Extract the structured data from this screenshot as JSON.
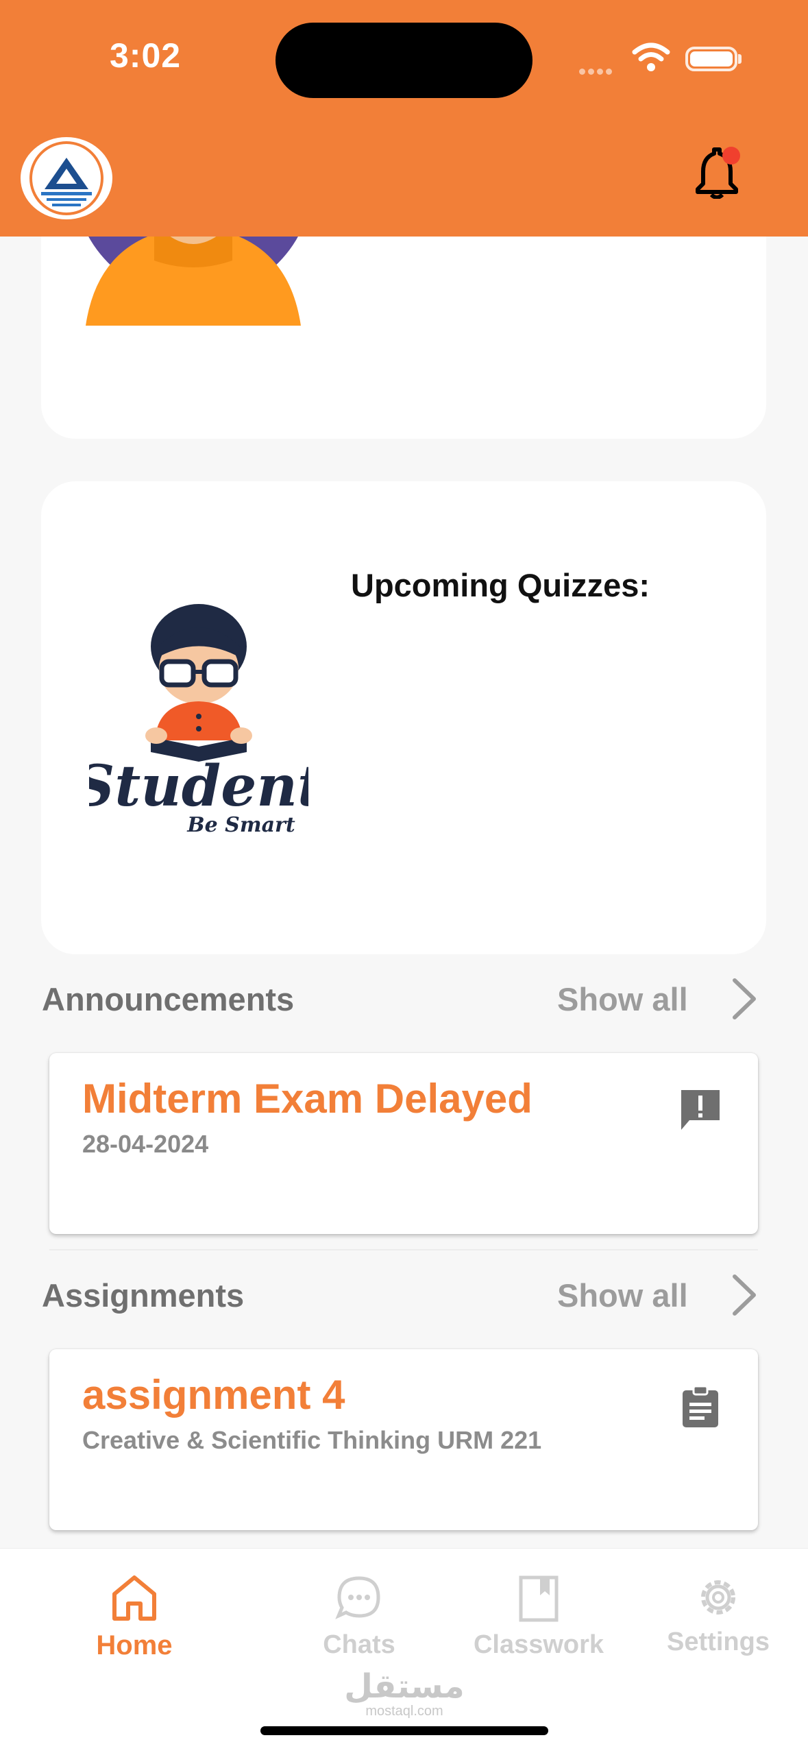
{
  "status_bar": {
    "time": "3:02"
  },
  "header": {
    "logo_icon": "school-logo",
    "bell_icon": "notification-bell-icon",
    "accent": "#f27f38"
  },
  "quiz_card": {
    "title": "Upcoming Quizzes:",
    "logo_text": "Student",
    "logo_tagline": "Be Smart"
  },
  "announcements": {
    "title": "Announcements",
    "show_all": "Show all",
    "items": [
      {
        "title": "Midterm Exam Delayed",
        "date": "28-04-2024",
        "icon": "announcement-icon"
      }
    ]
  },
  "assignments": {
    "title": "Assignments",
    "show_all": "Show all",
    "items": [
      {
        "title": "assignment 4",
        "course": "Creative & Scientific Thinking URM 221",
        "icon": "clipboard-icon"
      }
    ]
  },
  "nav": {
    "items": [
      {
        "label": "Home",
        "icon": "home-icon",
        "active": true
      },
      {
        "label": "Chats",
        "icon": "chat-icon",
        "active": false
      },
      {
        "label": "Classwork",
        "icon": "book-icon",
        "active": false
      },
      {
        "label": "Settings",
        "icon": "gear-icon",
        "active": false
      }
    ]
  },
  "watermark": {
    "arabic": "مستقل",
    "latin": "mostaql.com"
  }
}
